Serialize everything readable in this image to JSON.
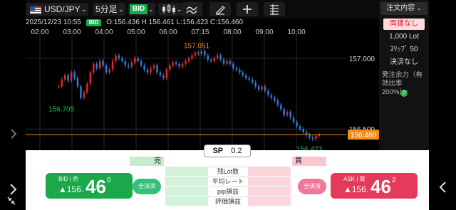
{
  "toolbar": {
    "symbol": "USD/JPY",
    "timeframe": "5分足",
    "price_type": "BID",
    "chart_style_icon": "candlestick-icon",
    "indicator_icon": "wave-lines-icon",
    "draw_icon": "pen-icon",
    "crosshair_icon": "plus-icon",
    "layers_icon": "list-bars-icon"
  },
  "info_bar": {
    "datetime": "2025/12/23 10:55",
    "badge": "BID",
    "ohlc": "O:156.436  H:156.461  L:156.423  C:156.460"
  },
  "time_axis": [
    "02:00",
    "03:00",
    "04:00",
    "05:00",
    "06:00",
    "07:15",
    "08:00",
    "09:00",
    "10:00"
  ],
  "price_axis": [
    "157.000",
    "156.500"
  ],
  "current_price": "156.460",
  "annotations": {
    "high": "157.051",
    "low1": "156.705",
    "low2": "156.423"
  },
  "order_panel": {
    "header": "注文内容",
    "options": [
      "両建なし",
      "1,000 Lot",
      "ｽﾘｯﾌﾟ 50",
      "決済なし"
    ],
    "margin_note": "発注余力（有効比率200%）:",
    "help": "?"
  },
  "spread": {
    "label": "SP",
    "value": "0.2"
  },
  "table": {
    "sell_header": "売",
    "buy_header": "買",
    "rows": [
      "残Lot数",
      "平均レート",
      "pip損益",
      "評価損益"
    ]
  },
  "bid_button": {
    "label": "BID | 売",
    "price_small": "▲156.",
    "price_big": "46",
    "price_sup": "0"
  },
  "ask_button": {
    "label": "ASK | 買",
    "price_small": "▲156.",
    "price_big": "46",
    "price_sup": "2"
  },
  "close_all_sell": "全決済",
  "close_all_buy": "全決済",
  "colors": {
    "up": "#e0262b",
    "down": "#2e78d6",
    "bid": "#1ba84a",
    "ask": "#e63a5a",
    "price_line": "#f28d1c"
  }
}
